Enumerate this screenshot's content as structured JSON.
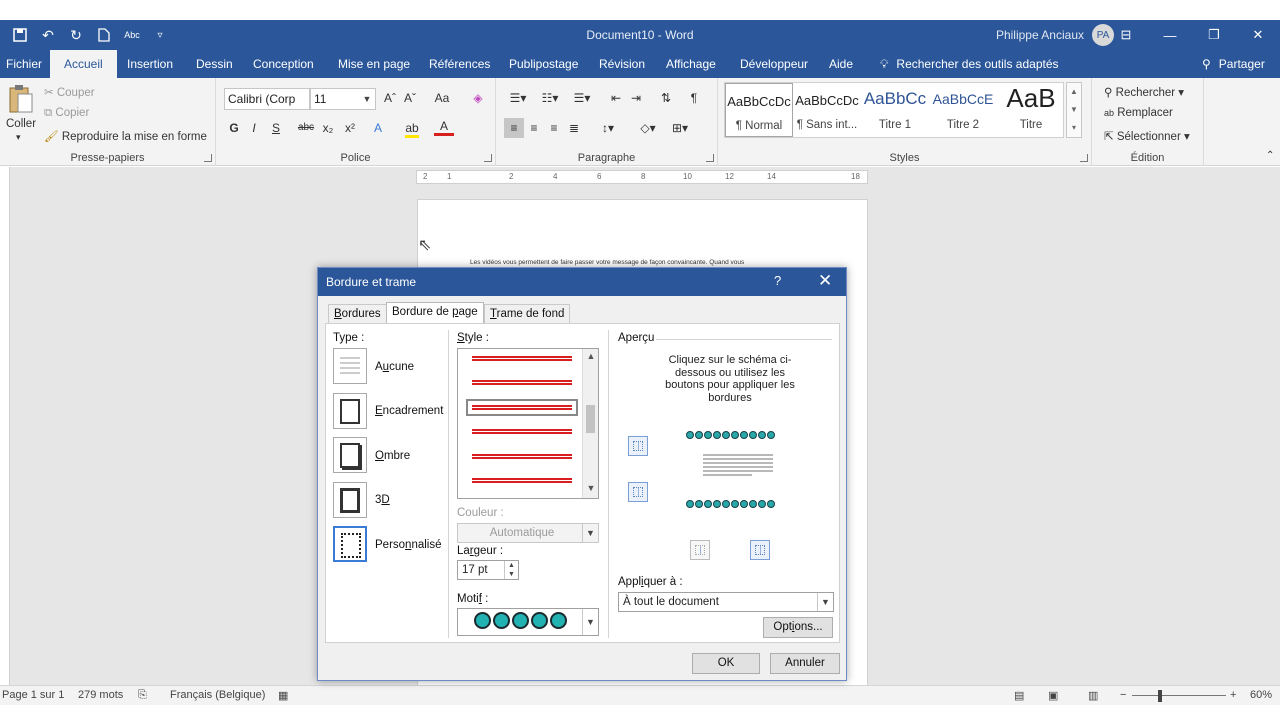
{
  "window": {
    "title": "Document10  -  Word",
    "user_name": "Philippe Anciaux",
    "user_initials": "PA",
    "qat_icons": [
      "save-icon",
      "undo-icon",
      "redo-icon",
      "new-doc-icon",
      "spelling-icon",
      "customize-icon"
    ],
    "qat_spelling": "Abc"
  },
  "tabs": [
    "Fichier",
    "Accueil",
    "Insertion",
    "Dessin",
    "Conception",
    "Mise en page",
    "Références",
    "Publipostage",
    "Révision",
    "Affichage",
    "Développeur",
    "Aide"
  ],
  "tell_me": "Rechercher des outils adaptés",
  "share": "Partager",
  "ribbon": {
    "clipboard": {
      "label": "Presse-papiers",
      "paste": "Coller",
      "cut": "Couper",
      "copy": "Copier",
      "format_painter": "Reproduire la mise en forme"
    },
    "font": {
      "label": "Police",
      "font_name": "Calibri (Corp",
      "font_size": "11",
      "grow": "Aˆ",
      "shrink": "Aˇ",
      "case": "Aa",
      "bold": "G",
      "italic": "I",
      "underline": "S",
      "strike": "abc",
      "subscript": "x₂",
      "superscript": "x²",
      "text_effects": "A",
      "font_color": "A"
    },
    "paragraph": {
      "label": "Paragraphe",
      "show_marks": "¶"
    },
    "styles": {
      "label": "Styles",
      "items": [
        {
          "sample": "AaBbCcDc",
          "name": "¶ Normal"
        },
        {
          "sample": "AaBbCcDc",
          "name": "¶ Sans int..."
        },
        {
          "sample": "AaBbCc",
          "name": "Titre 1"
        },
        {
          "sample": "AaBbCcE",
          "name": "Titre 2"
        },
        {
          "sample": "AaB",
          "name": "Titre"
        }
      ]
    },
    "editing": {
      "label": "Édition",
      "find": "Rechercher",
      "replace": "Remplacer",
      "select": "Sélectionner"
    }
  },
  "ruler": [
    "2",
    "1",
    "2",
    "4",
    "6",
    "8",
    "10",
    "12",
    "14",
    "18"
  ],
  "document": {
    "text": "Les vidéos vous permettent de faire passer votre message de façon convaincante. Quand vous"
  },
  "statusbar": {
    "page": "Page 1 sur 1",
    "words": "279 mots",
    "language": "Français (Belgique)",
    "zoom": "60%",
    "zoom_level": 0.6
  },
  "dialog": {
    "title": "Bordure et trame",
    "help": "?",
    "tabs": [
      {
        "label": "Bordures",
        "ul": "B",
        "rest": "ordures"
      },
      {
        "label": "Bordure de page",
        "pre": "Bordure de ",
        "ul": "p",
        "rest": "age"
      },
      {
        "label": "Trame de fond",
        "ul": "T",
        "rest": "rame de fond"
      }
    ],
    "type_label": "Type :",
    "types": [
      {
        "pre": "A",
        "ul": "u",
        "rest": "cune"
      },
      {
        "pre": "",
        "ul": "E",
        "rest": "ncadrement"
      },
      {
        "pre": "",
        "ul": "O",
        "rest": "mbre"
      },
      {
        "pre": "3",
        "ul": "D",
        "rest": ""
      },
      {
        "pre": "Perso",
        "ul": "n",
        "rest": "nalisé"
      }
    ],
    "style_label": {
      "ul": "S",
      "rest": "tyle :"
    },
    "color_label": "Couleur :",
    "color_value": "Automatique",
    "width_label": {
      "pre": "La",
      "ul": "r",
      "rest": "geur :"
    },
    "width_value": "17 pt",
    "motif_label": {
      "pre": "Moti",
      "ul": "f",
      "rest": " :"
    },
    "preview_label": "Aperçu",
    "preview_text": "Cliquez sur le schéma ci-dessous ou utilisez les boutons pour appliquer les bordures",
    "apply_label": {
      "pre": "Appl",
      "ul": "i",
      "rest": "quer à :"
    },
    "apply_value": "À tout le document",
    "options": {
      "pre": "Opt",
      "ul": "i",
      "rest": "ons..."
    },
    "ok": "OK",
    "cancel": "Annuler"
  },
  "colors": {
    "accent": "#2b579a",
    "style_line": "#d81e1e",
    "motif": "#23b2b2"
  }
}
